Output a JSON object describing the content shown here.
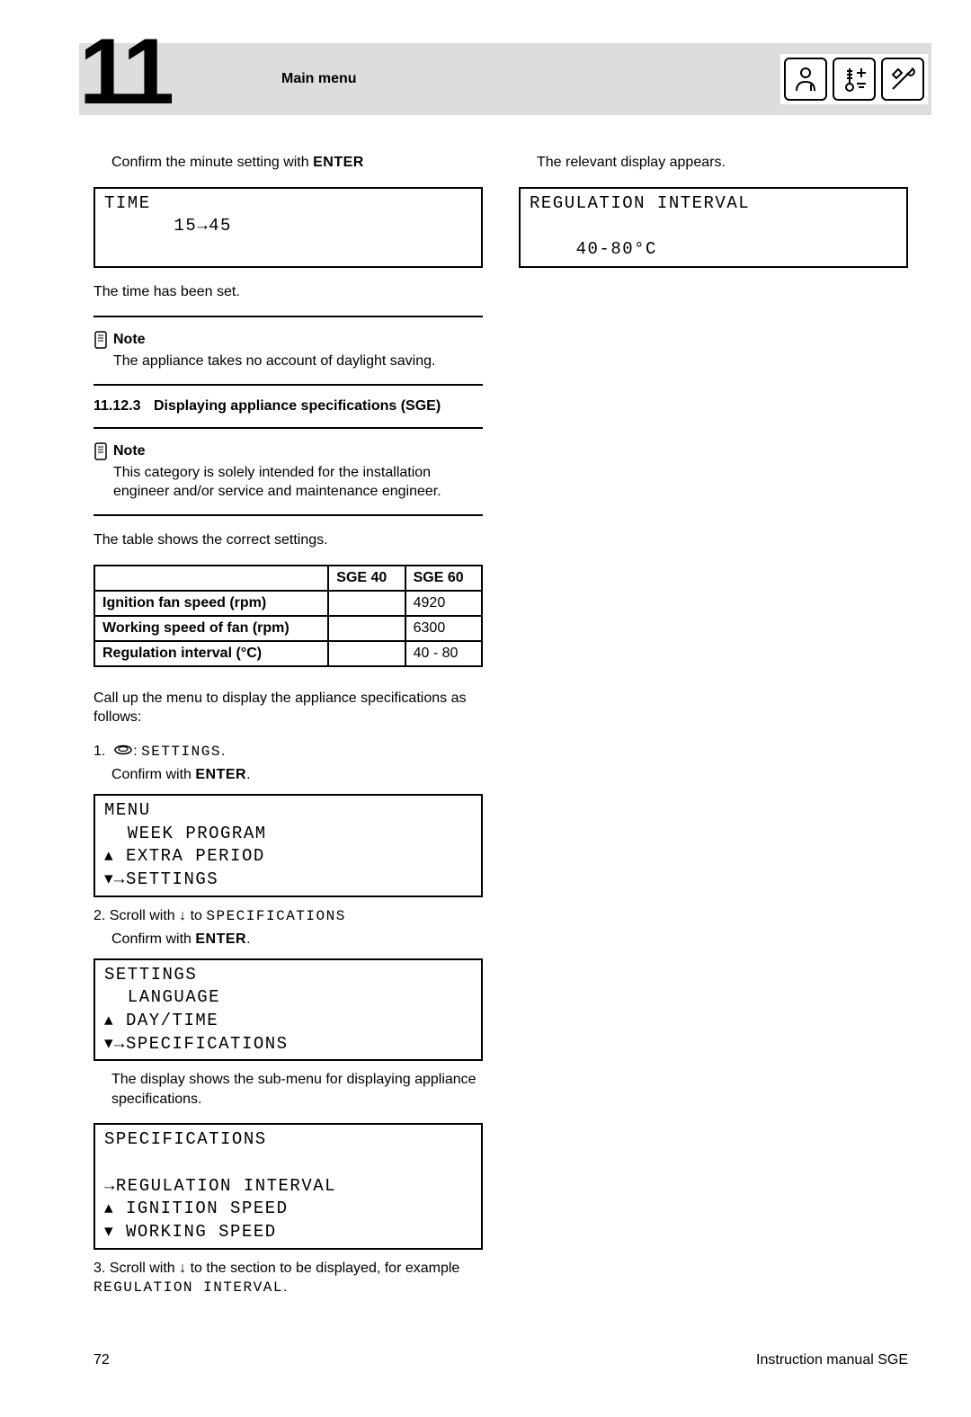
{
  "header": {
    "chapter_number": "11",
    "title": "Main menu",
    "icons": [
      "installer-icon",
      "temperature-icon",
      "tools-icon"
    ]
  },
  "left": {
    "confirm_minute": "Confirm the minute setting with ",
    "enter": "ENTER",
    "lcd_time_title": "TIME",
    "lcd_time_value": "15→45",
    "time_set": "The time has been set.",
    "note1_label": "Note",
    "note1_text": "The appliance takes no account of daylight saving.",
    "sect_num": "11.12.3",
    "sect_title": "Displaying appliance specifications (SGE)",
    "note2_label": "Note",
    "note2_text": "This category is solely intended for the installation engineer and/or service and maintenance engineer.",
    "table_intro": "The table shows the correct settings.",
    "settings_step_with_dial_prefix": "1.  ",
    "settings_step_with_dial_suffix": ": ",
    "settings_step_label": "SETTINGS",
    "confirm_with": "Confirm with ",
    "lcd_menu": {
      "title": "MENU",
      "lines": [
        "  WEEK PROGRAM",
        "▴ EXTRA PERIOD",
        "▾→SETTINGS"
      ]
    },
    "scroll2_prefix": "2.  Scroll with ",
    "scroll2_suffix": " to ",
    "scroll2_target": "SPECIFICATIONS",
    "lcd_settings": {
      "title": "SETTINGS",
      "lines": [
        "  LANGUAGE",
        "▴ DAY/TIME",
        "▾→SPECIFICATIONS"
      ]
    },
    "submenu_text": "The display shows the sub-menu for displaying appliance specifications.",
    "lcd_specs": {
      "title": "SPECIFICATIONS",
      "blank": " ",
      "lines": [
        "→REGULATION INTERVAL",
        "▴ IGNITION SPEED",
        "▾ WORKING SPEED"
      ]
    },
    "scroll3_prefix": "3.  Scroll with ",
    "scroll3_middle": " to the section to be displayed, for example ",
    "scroll3_target": "REGULATION INTERVAL",
    "scroll3_period": "."
  },
  "right": {
    "relevant_display": "The relevant display appears.",
    "lcd_reg": {
      "title": "REGULATION INTERVAL",
      "value": "    40-80°C"
    }
  },
  "chart_data": {
    "type": "table",
    "columns": [
      "",
      "SGE 40",
      "SGE 60"
    ],
    "rows": [
      {
        "label": "Ignition fan speed (rpm)",
        "sge40": "",
        "sge60": "4920"
      },
      {
        "label": "Working speed of fan (rpm)",
        "sge40": "",
        "sge60": "6300"
      },
      {
        "label": "Regulation interval (°C)",
        "sge40": "",
        "sge60": "40 - 80"
      }
    ]
  },
  "footer": {
    "page": "72",
    "manual": "Instruction manual SGE"
  }
}
